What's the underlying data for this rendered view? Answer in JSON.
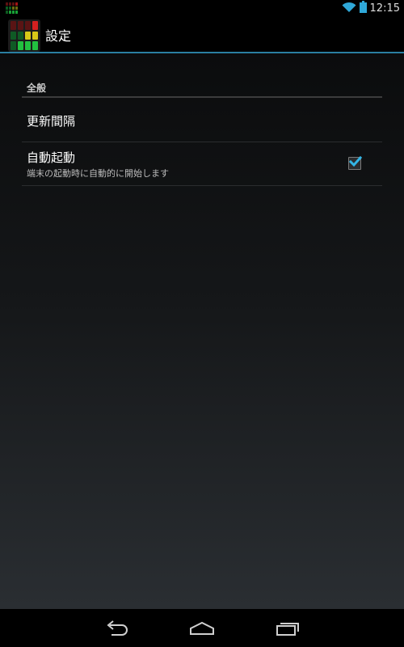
{
  "status_bar": {
    "time": "12:15",
    "icons": [
      "app-notification-icon",
      "wifi-icon",
      "battery-icon"
    ]
  },
  "action_bar": {
    "title": "設定",
    "icon": "app-level-meter-icon",
    "accent_color": "#2a7fa1"
  },
  "preferences": {
    "category": "全般",
    "items": [
      {
        "title": "更新間隔",
        "summary": ""
      },
      {
        "title": "自動起動",
        "summary": "端末の起動時に自動的に開始します",
        "checked": true
      }
    ]
  },
  "nav_bar": {
    "buttons": [
      "back-icon",
      "home-icon",
      "recent-apps-icon"
    ]
  }
}
